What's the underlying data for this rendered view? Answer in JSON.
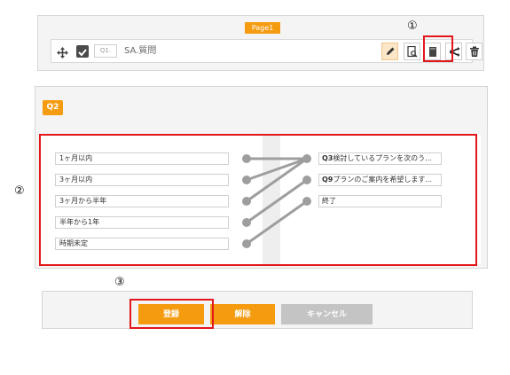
{
  "page_badge": "Page1",
  "q1": {
    "number": "Q1.",
    "title": "SA.質問"
  },
  "q2": {
    "badge": "Q2",
    "options": [
      "1ヶ月以内",
      "3ヶ月以内",
      "3ヶ月から半年",
      "半年から1年",
      "時期未定"
    ],
    "targets": [
      {
        "prefix": "Q3",
        "text": "検討しているプランを次のう..."
      },
      {
        "prefix": "Q9",
        "text": "プランのご案内を希望します..."
      },
      {
        "prefix": "",
        "text": "終了"
      }
    ],
    "connections": [
      [
        0,
        0
      ],
      [
        1,
        0
      ],
      [
        2,
        0
      ],
      [
        3,
        1
      ],
      [
        4,
        2
      ]
    ]
  },
  "buttons": {
    "register": "登録",
    "release": "解除",
    "cancel": "キャンセル"
  },
  "callouts": {
    "c1": "①",
    "c2": "②",
    "c3": "③"
  },
  "colors": {
    "accent": "#f59b10",
    "highlight": "#e3161b",
    "connector": "#9e9e9e"
  }
}
